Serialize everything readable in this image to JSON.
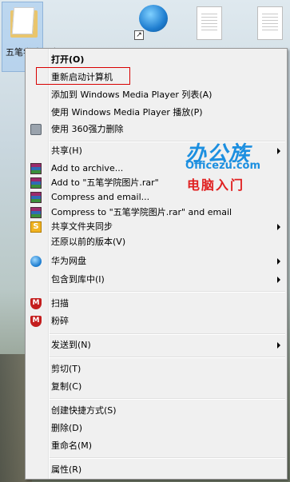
{
  "desktop": {
    "selected_icon_label": "五笔学院图片",
    "icons": [
      {
        "name": "folder-icon"
      },
      {
        "name": "globe-app-icon"
      },
      {
        "name": "document-icon"
      },
      {
        "name": "document-icon"
      }
    ]
  },
  "menu": {
    "open": "打开(O)",
    "restart_calc": "重新启动计算机",
    "add_wmp_list": "添加到 Windows Media Player 列表(A)",
    "play_wmp": "使用 Windows Media Player 播放(P)",
    "delete_360": "使用 360强力删除",
    "share": "共享(H)",
    "add_archive": "Add to archive...",
    "add_rar": "Add to \"五笔学院图片.rar\"",
    "compress_email": "Compress and email...",
    "compress_rar_email": "Compress to \"五笔学院图片.rar\" and email",
    "shared_folder_sync": "共享文件夹同步",
    "restore_prev": "还原以前的版本(V)",
    "huawei_drive": "华为网盘",
    "include_library": "包含到库中(I)",
    "scan": "扫描",
    "shred": "粉碎",
    "send_to": "发送到(N)",
    "cut": "剪切(T)",
    "copy": "复制(C)",
    "create_shortcut": "创建快捷方式(S)",
    "delete": "删除(D)",
    "rename": "重命名(M)",
    "properties": "属性(R)"
  },
  "watermark": {
    "line1": "办公族",
    "line2": "Officezu.com",
    "line3": "电脑入门"
  },
  "colors": {
    "menu_bg": "#f0f0f0",
    "highlight_border": "#d80000",
    "logo_blue": "#1c8fe0",
    "logo_red": "#e02020"
  }
}
